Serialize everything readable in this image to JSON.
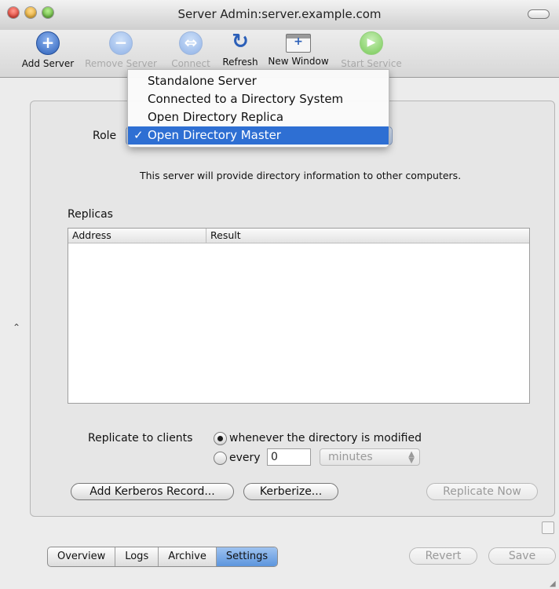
{
  "window": {
    "title": "Server Admin:server.example.com"
  },
  "toolbar": {
    "items": [
      {
        "label": "Add Server",
        "icon": "add-server-icon",
        "enabled": true
      },
      {
        "label": "Remove Server",
        "icon": "remove-server-icon",
        "enabled": false
      },
      {
        "label": "Connect",
        "icon": "connect-icon",
        "enabled": false
      },
      {
        "label": "Refresh",
        "icon": "refresh-icon",
        "enabled": true
      },
      {
        "label": "New Window",
        "icon": "new-window-icon",
        "enabled": true
      },
      {
        "label": "Start Service",
        "icon": "start-service-icon",
        "enabled": false
      }
    ]
  },
  "role": {
    "label": "Role",
    "selected": "Open Directory Master",
    "options": [
      "Standalone Server",
      "Connected to a Directory System",
      "Open Directory Replica",
      "Open Directory Master"
    ]
  },
  "description": "This server will provide directory information to other computers.",
  "replicas": {
    "label": "Replicas",
    "columns": [
      "Address",
      "Result"
    ],
    "rows": []
  },
  "replicate": {
    "label": "Replicate to clients",
    "option1": "whenever the directory is modified",
    "option2": "every",
    "interval_value": "0",
    "interval_unit": "minutes",
    "selected_option": 1
  },
  "buttons": {
    "add_kerberos": "Add Kerberos Record...",
    "kerberize": "Kerberize...",
    "replicate_now": "Replicate Now",
    "revert": "Revert",
    "save": "Save"
  },
  "tabs": [
    "Overview",
    "Logs",
    "Archive",
    "Settings"
  ],
  "active_tab": "Settings",
  "colors": {
    "selection": "#2e6fd3",
    "active_tab": "#7aaaea"
  }
}
